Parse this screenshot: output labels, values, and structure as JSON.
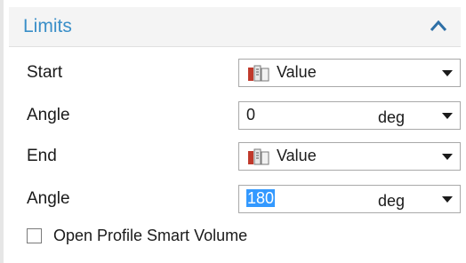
{
  "section": {
    "title": "Limits",
    "collapse_icon": "chevron-up-icon",
    "accent_color": "#3a8fc8"
  },
  "rows": [
    {
      "label": "Start",
      "value": "Value",
      "icon": "value-icon"
    },
    {
      "label": "Angle",
      "value": "0",
      "unit": "deg"
    },
    {
      "label": "End",
      "value": "Value",
      "icon": "value-icon"
    },
    {
      "label": "Angle",
      "value": "180",
      "unit": "deg",
      "selected": true
    }
  ],
  "checkbox": {
    "label": "Open Profile Smart Volume",
    "checked": false
  },
  "colors": {
    "selection": "#3399ff",
    "field_border": "#a9a9a9"
  }
}
